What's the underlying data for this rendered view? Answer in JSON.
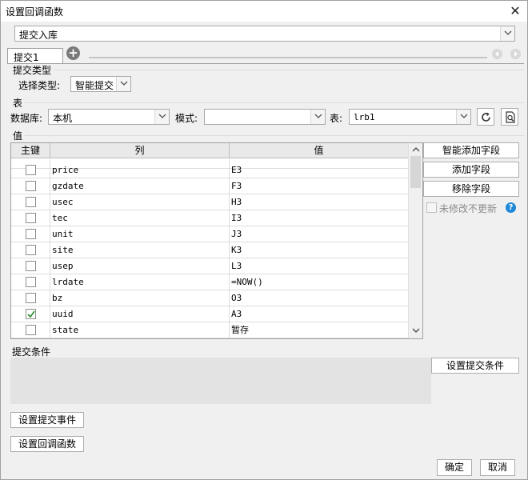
{
  "window": {
    "title": "设置回调函数",
    "close_icon": "close-icon"
  },
  "callback_select": {
    "value": "提交入库"
  },
  "tabs": [
    {
      "label": "提交1"
    }
  ],
  "submit_type": {
    "section_label": "提交类型",
    "label": "选择类型:",
    "value": "智能提交"
  },
  "table_section": {
    "section_label": "表",
    "db_label": "数据库:",
    "db_value": "本机",
    "mode_label": "模式:",
    "mode_value": "",
    "table_label": "表:",
    "table_value": "lrb1"
  },
  "value_section": {
    "section_label": "值",
    "columns": [
      "主键",
      "列",
      "值"
    ],
    "rows": [
      {
        "key": false,
        "col": "price",
        "val": "E3"
      },
      {
        "key": false,
        "col": "gzdate",
        "val": "F3"
      },
      {
        "key": false,
        "col": "usec",
        "val": "H3"
      },
      {
        "key": false,
        "col": "tec",
        "val": "I3"
      },
      {
        "key": false,
        "col": "unit",
        "val": "J3"
      },
      {
        "key": false,
        "col": "site",
        "val": "K3"
      },
      {
        "key": false,
        "col": "usep",
        "val": "L3"
      },
      {
        "key": false,
        "col": "lrdate",
        "val": "=NOW()"
      },
      {
        "key": false,
        "col": "bz",
        "val": "O3"
      },
      {
        "key": true,
        "col": "uuid",
        "val": "A3"
      },
      {
        "key": false,
        "col": "state",
        "val": "暂存"
      }
    ],
    "buttons": {
      "smart_add": "智能添加字段",
      "add": "添加字段",
      "remove": "移除字段"
    },
    "no_update_label": "未修改不更新",
    "no_update_checked": false
  },
  "condition_section": {
    "section_label": "提交条件",
    "set_button": "设置提交条件"
  },
  "bottom_buttons": {
    "submit_event": "设置提交事件",
    "callback": "设置回调函数"
  },
  "footer": {
    "ok": "确定",
    "cancel": "取消"
  }
}
